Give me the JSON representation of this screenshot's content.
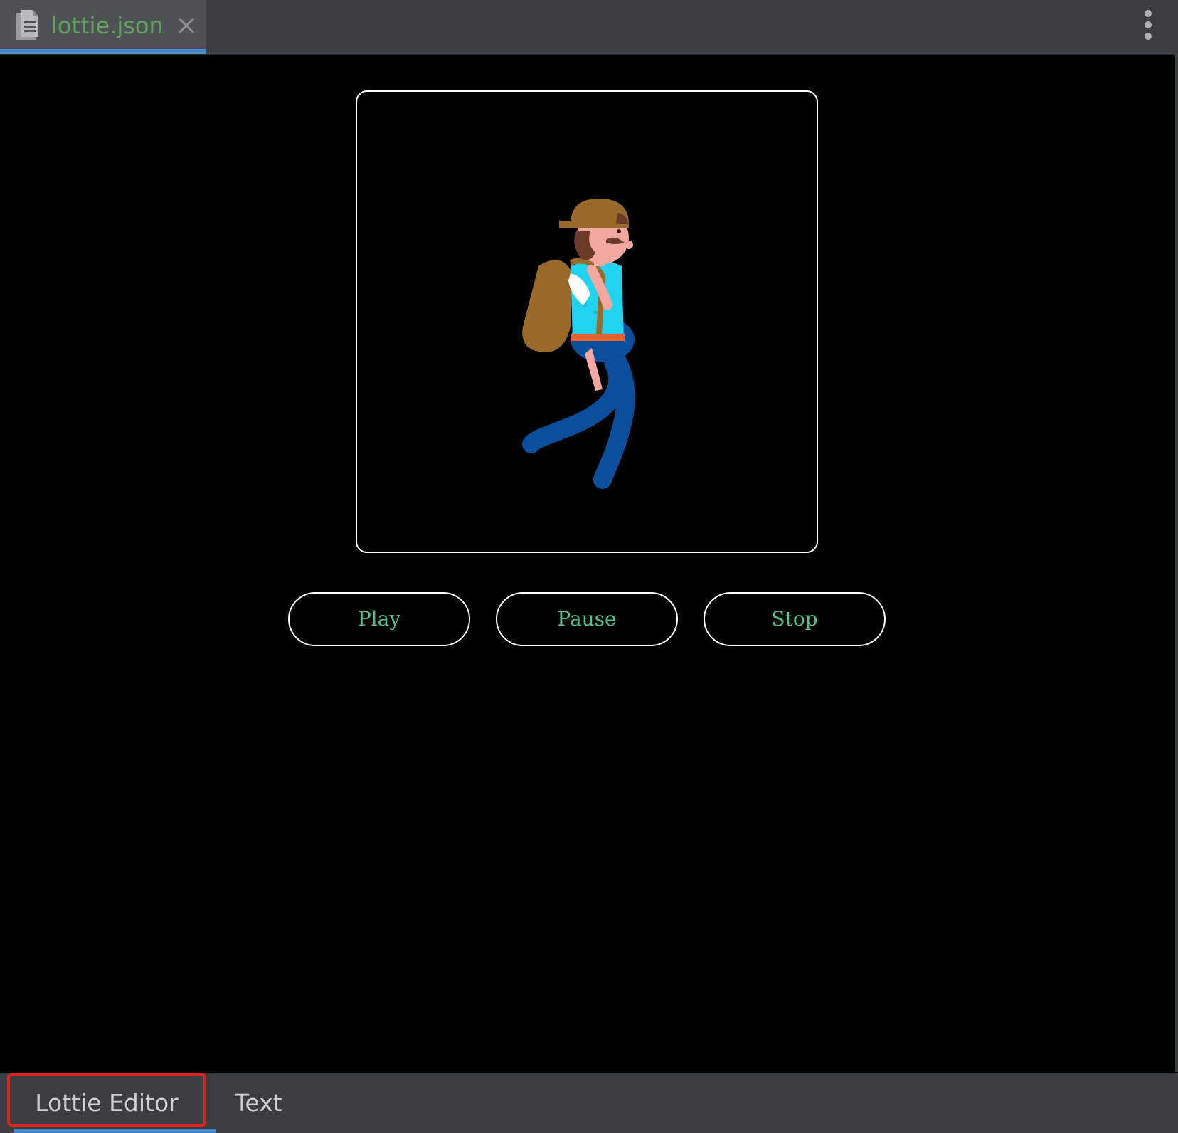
{
  "tab_bar": {
    "file_tab": {
      "name": "lottie.json",
      "icon": "json-file-icon",
      "close_icon": "close-icon"
    },
    "menu_icon": "more-vertical-icon"
  },
  "viewer": {
    "animation": {
      "subject": "walking hiker with backpack",
      "colors": {
        "hat": "#9a6a2a",
        "skin": "#f2a7a0",
        "hair": "#6b3b2a",
        "shirt": "#22d3ee",
        "pants": "#0b4f9c",
        "backpack": "#9a6a2a",
        "belt": "#e8622a"
      }
    },
    "controls": {
      "play": "Play",
      "pause": "Pause",
      "stop": "Stop"
    }
  },
  "bottom_tabs": {
    "lottie_editor": "Lottie Editor",
    "text": "Text"
  },
  "colors": {
    "accent": "#4a88c7",
    "tab_text": "#62a45e",
    "button_text": "#4ec383",
    "highlight": "#e0221e"
  }
}
